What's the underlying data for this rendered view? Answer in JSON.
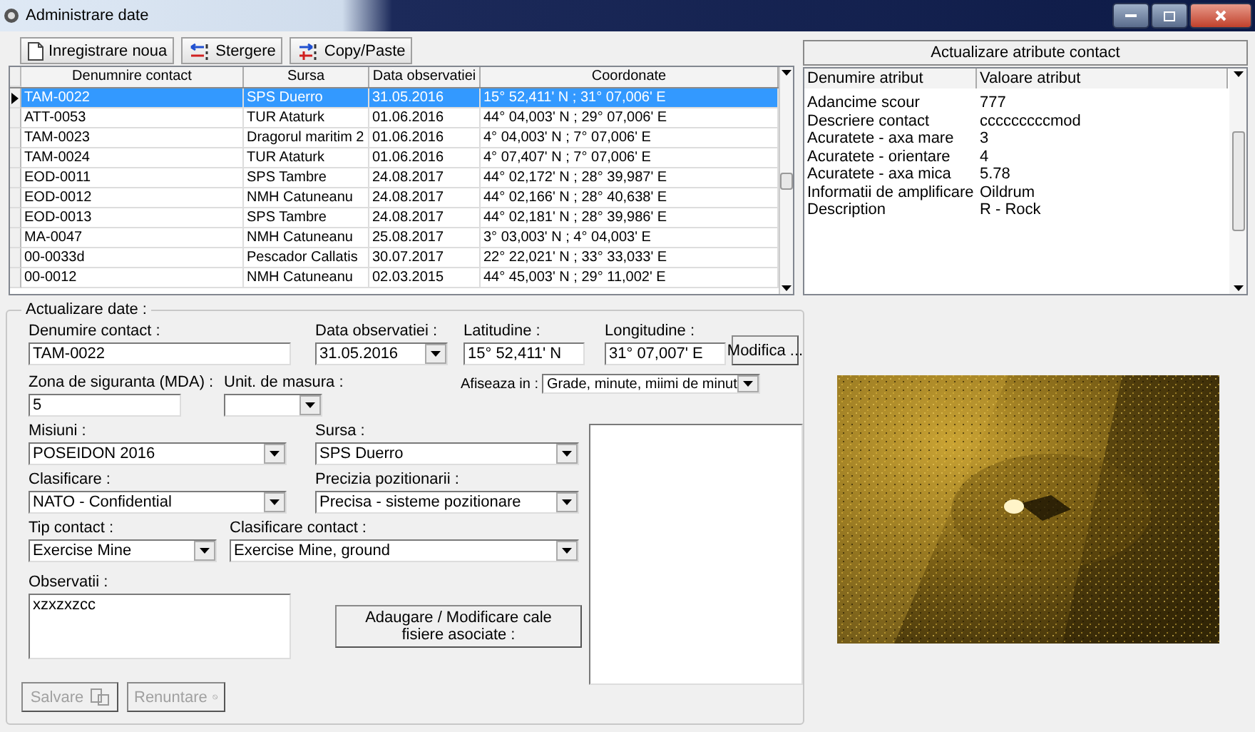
{
  "window": {
    "title": "Administrare date"
  },
  "toolbar": [
    {
      "kind": "new",
      "label": "Inregistrare noua"
    },
    {
      "kind": "delete",
      "label": "Stergere"
    },
    {
      "kind": "copy",
      "label": "Copy/Paste"
    }
  ],
  "contacts": {
    "columns": [
      "Denumnire contact",
      "Sursa",
      "Data observatiei",
      "Coordonate"
    ],
    "rows": [
      {
        "selected": true,
        "cells": [
          "TAM-0022",
          "SPS Duerro",
          "31.05.2016",
          "15° 52,411' N ; 31° 07,006' E"
        ]
      },
      {
        "selected": false,
        "cells": [
          "ATT-0053",
          "TUR Ataturk",
          "01.06.2016",
          "44° 04,003' N ; 29° 07,006' E"
        ]
      },
      {
        "selected": false,
        "cells": [
          "TAM-0023",
          "Dragorul maritim 2",
          "01.06.2016",
          "4° 04,003' N ; 7° 07,006' E"
        ]
      },
      {
        "selected": false,
        "cells": [
          "TAM-0024",
          "TUR Ataturk",
          "01.06.2016",
          "4° 07,407' N ; 7° 07,006' E"
        ]
      },
      {
        "selected": false,
        "cells": [
          "EOD-0011",
          "SPS Tambre",
          "24.08.2017",
          "44° 02,172' N ; 28° 39,987' E"
        ]
      },
      {
        "selected": false,
        "cells": [
          "EOD-0012",
          "NMH Catuneanu",
          "24.08.2017",
          "44° 02,166' N ; 28° 40,638' E"
        ]
      },
      {
        "selected": false,
        "cells": [
          "EOD-0013",
          "SPS Tambre",
          "24.08.2017",
          "44° 02,181' N ; 28° 39,986' E"
        ]
      },
      {
        "selected": false,
        "cells": [
          "MA-0047",
          "NMH Catuneanu",
          "25.08.2017",
          "3° 03,003' N ; 4° 04,003' E"
        ]
      },
      {
        "selected": false,
        "cells": [
          "00-0033d",
          "Pescador Callatis",
          "30.07.2017",
          "22° 22,021' N ; 33° 33,033' E"
        ]
      },
      {
        "selected": false,
        "cells": [
          "00-0012",
          "NMH Catuneanu",
          "02.03.2015",
          "44° 45,003' N ; 29° 11,002' E"
        ]
      }
    ]
  },
  "attributes": {
    "button": "Actualizare atribute contact",
    "columns": [
      "Denumire atribut",
      "Valoare atribut"
    ],
    "rows": [
      [
        "Adancime scour",
        "777"
      ],
      [
        "Descriere contact",
        "cccccccccmod"
      ],
      [
        "Acuratete - axa mare",
        "3"
      ],
      [
        "Acuratete - orientare",
        "4"
      ],
      [
        "Acuratete - axa mica",
        "5.78"
      ],
      [
        "Informatii de amplificare",
        "Oildrum"
      ],
      [
        "Description",
        "R - Rock"
      ]
    ]
  },
  "form": {
    "title": "Actualizare date :",
    "top_rows": [
      [
        {
          "kind": "text",
          "label": "Denumire contact :",
          "value": "TAM-0022"
        },
        {
          "kind": "combo",
          "label": "Data observatiei :",
          "value": "31.05.2016"
        },
        {
          "kind": "text",
          "label": "Latitudine :",
          "value": "15° 52,411' N"
        },
        {
          "kind": "text",
          "label": "Longitudine :",
          "value": "31° 07,007' E"
        },
        {
          "kind": "button",
          "label": "Modifica ...",
          "disabled": false
        }
      ],
      [
        {
          "kind": "text",
          "label": "Zona de siguranta (MDA) :",
          "value": "5"
        },
        {
          "kind": "combo",
          "label": "Unit. de masura :"
        },
        {
          "kind": "inline_combo",
          "label": "Afiseaza in :",
          "value": "Grade, minute, miimi de minut"
        }
      ]
    ],
    "left_rows": [
      [
        {
          "kind": "combo",
          "label": "Misiuni :",
          "value": "POSEIDON 2016"
        },
        {
          "kind": "combo",
          "label": "Sursa :",
          "value": "SPS Duerro"
        }
      ],
      [
        {
          "kind": "combo",
          "label": "Clasificare :",
          "value": "NATO - Confidential"
        },
        {
          "kind": "combo",
          "label": "Precizia pozitionarii :",
          "value": "Precisa - sisteme pozitionare"
        }
      ],
      [
        {
          "kind": "combo",
          "label": "Tip contact :",
          "value": "Exercise Mine"
        },
        {
          "kind": "combo",
          "label": "Clasificare contact :",
          "value": "Exercise Mine, ground"
        }
      ],
      [
        {
          "kind": "memo",
          "label": "Observatii :",
          "value": "xzxzxzcc"
        },
        {
          "kind": "button",
          "label": "Adaugare / Modificare cale fisiere asociate :",
          "disabled": false
        }
      ]
    ],
    "actions": [
      {
        "kind": "save",
        "label": "Salvare",
        "disabled": true
      },
      {
        "kind": "cancel",
        "label": "Renuntare",
        "disabled": true
      }
    ]
  }
}
